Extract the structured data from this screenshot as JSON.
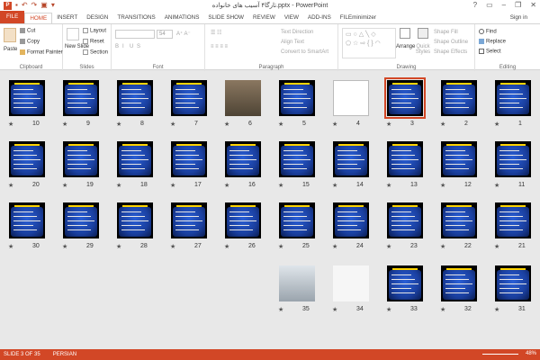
{
  "title": "تارگا۴ آسیب های خانواده.pptx - PowerPoint",
  "tabs": [
    "FILE",
    "HOME",
    "INSERT",
    "DESIGN",
    "TRANSITIONS",
    "ANIMATIONS",
    "SLIDE SHOW",
    "REVIEW",
    "VIEW",
    "ADD-INS",
    "FILEminimizer"
  ],
  "active_tab": "HOME",
  "signin": "Sign in",
  "ribbon": {
    "clipboard": {
      "paste": "Paste",
      "cut": "Cut",
      "copy": "Copy",
      "format_painter": "Format Painter",
      "name": "Clipboard"
    },
    "slides": {
      "new_slide": "New Slide",
      "layout": "Layout",
      "reset": "Reset",
      "section": "Section",
      "name": "Slides"
    },
    "font": {
      "size": "54",
      "bold": "B",
      "italic": "I",
      "underline": "U",
      "strike": "S",
      "name": "Font"
    },
    "paragraph": {
      "text_direction": "Text Direction",
      "align_text": "Align Text",
      "convert": "Convert to SmartArt",
      "name": "Paragraph"
    },
    "drawing": {
      "arrange": "Arrange",
      "quick_styles": "Quick Styles",
      "shape_fill": "Shape Fill",
      "shape_outline": "Shape Outline",
      "shape_effects": "Shape Effects",
      "name": "Drawing"
    },
    "editing": {
      "find": "Find",
      "replace": "Replace",
      "select": "Select",
      "name": "Editing"
    }
  },
  "slide_rows": [
    [
      "10",
      "9",
      "8",
      "7",
      "6",
      "5",
      "4",
      "3",
      "2",
      "1"
    ],
    [
      "20",
      "19",
      "18",
      "17",
      "16",
      "15",
      "14",
      "13",
      "12",
      "11"
    ],
    [
      "30",
      "29",
      "28",
      "27",
      "26",
      "25",
      "24",
      "23",
      "22",
      "21"
    ],
    [
      "35",
      "34",
      "33",
      "32",
      "31"
    ]
  ],
  "selected_slide": "3",
  "status": {
    "slide": "SLIDE 3 OF 35",
    "language": "PERSIAN",
    "zoom": "48%"
  }
}
